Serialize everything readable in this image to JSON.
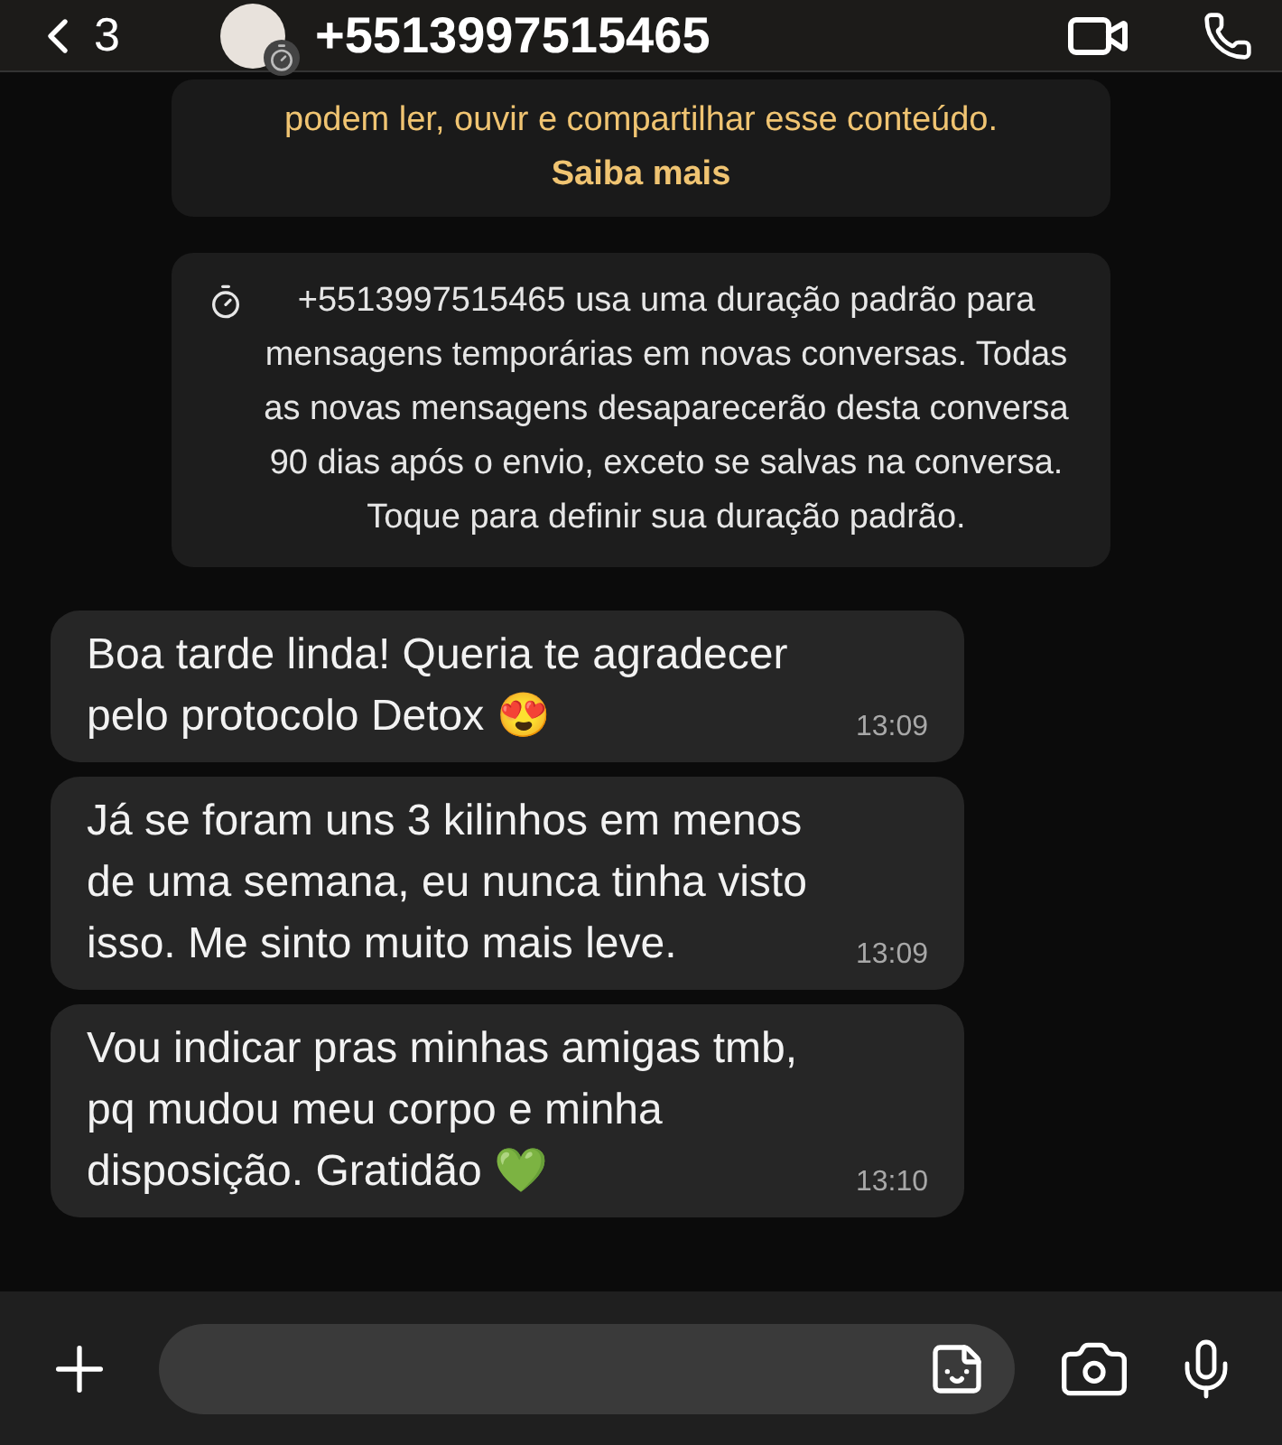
{
  "header": {
    "back_count": "3",
    "contact": "+5513997515465"
  },
  "encryption_notice": {
    "text": "podem ler, ouvir e compartilhar esse conteúdo.",
    "link": "Saiba mais"
  },
  "system_message": {
    "text": "+5513997515465 usa uma duração padrão para mensagens temporárias em novas conversas. Todas as novas mensagens desaparecerão desta conversa 90 dias após o envio, exceto se salvas na conversa. Toque para definir sua duração padrão."
  },
  "messages": [
    {
      "text": "Boa tarde linda! Queria te agradecer pelo protocolo Detox 😍",
      "time": "13:09"
    },
    {
      "text": "Já se foram uns 3 kilinhos em menos de uma semana, eu nunca tinha visto isso. Me sinto muito mais leve.",
      "time": "13:09"
    },
    {
      "text": "Vou indicar pras minhas amigas tmb, pq mudou meu corpo e minha disposição. Gratidão 💚",
      "time": "13:10"
    }
  ]
}
